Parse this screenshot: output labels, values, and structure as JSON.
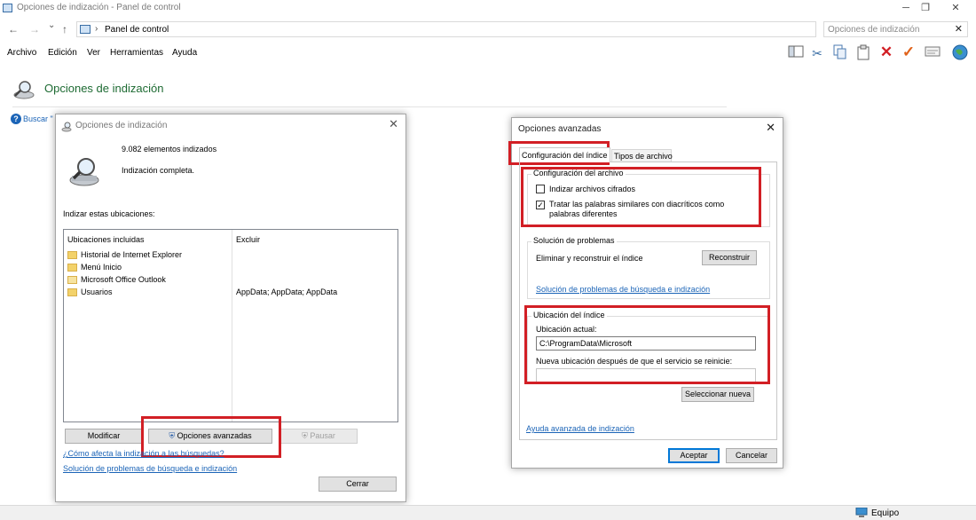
{
  "window": {
    "title": "Opciones de indización - Panel de control",
    "minimize": "─",
    "restore": "❐",
    "close": "✕"
  },
  "address": {
    "back": "←",
    "forward": "→",
    "dropdown": "⌄",
    "up": "↑",
    "breadcrumb": "Panel de control",
    "search_placeholder": "Opciones de indización",
    "clear": "✕"
  },
  "menu": [
    "Archivo",
    "Edición",
    "Ver",
    "Herramientas",
    "Ayuda"
  ],
  "toolbar_icons": [
    "panel-icon",
    "cut-icon",
    "copy-icon",
    "paste-icon",
    "delete-icon",
    "checkmark-icon",
    "mail-icon",
    "globe-icon"
  ],
  "header": {
    "title": "Opciones de indización"
  },
  "help_link": "Buscar \"",
  "indexing_dialog": {
    "title": "Opciones de indización",
    "items_indexed": "9.082 elementos indizados",
    "status": "Indización completa.",
    "locations_label": "Indizar estas ubicaciones:",
    "columns": [
      "Ubicaciones incluidas",
      "Excluir"
    ],
    "rows": [
      {
        "name": "Historial de Internet Explorer",
        "exclude": "",
        "icon": "ie-history-icon"
      },
      {
        "name": "Menú Inicio",
        "exclude": "",
        "icon": "folder-icon"
      },
      {
        "name": "Microsoft Office Outlook",
        "exclude": "",
        "icon": "outlook-icon"
      },
      {
        "name": "Usuarios",
        "exclude": "AppData; AppData; AppData",
        "icon": "folder-icon"
      }
    ],
    "modify_button": "Modificar",
    "advanced_button": "Opciones avanzadas",
    "pause_button": "Pausar",
    "link_affects": "¿Cómo afecta la indización a las búsquedas?",
    "link_troubleshoot": "Solución de problemas de búsqueda e indización",
    "close_button": "Cerrar"
  },
  "advanced_dialog": {
    "title": "Opciones avanzadas",
    "tabs": [
      "Configuración del índice",
      "Tipos de archivo"
    ],
    "file_settings": {
      "title": "Configuración del archivo",
      "encrypt_label": "Indizar archivos cifrados",
      "encrypt_checked": false,
      "diacritics_label": "Tratar las palabras similares con diacríticos como palabras diferentes",
      "diacritics_checked": true
    },
    "troubleshooting": {
      "title": "Solución de problemas",
      "rebuild_text": "Eliminar y reconstruir el índice",
      "rebuild_button": "Reconstruir",
      "link": "Solución de problemas de búsqueda e indización"
    },
    "index_location": {
      "title": "Ubicación del índice",
      "current_label": "Ubicación actual:",
      "current_value": "C:\\ProgramData\\Microsoft",
      "new_label": "Nueva ubicación después de que el servicio se reinicie:",
      "new_value": "",
      "select_button": "Seleccionar nueva"
    },
    "help_link": "Ayuda avanzada de indización",
    "ok_button": "Aceptar",
    "cancel_button": "Cancelar"
  },
  "statusbar": {
    "label": "Equipo"
  },
  "colors": {
    "highlight": "#d21f25",
    "link": "#1b64b7",
    "header_green": "#1e6b33"
  }
}
